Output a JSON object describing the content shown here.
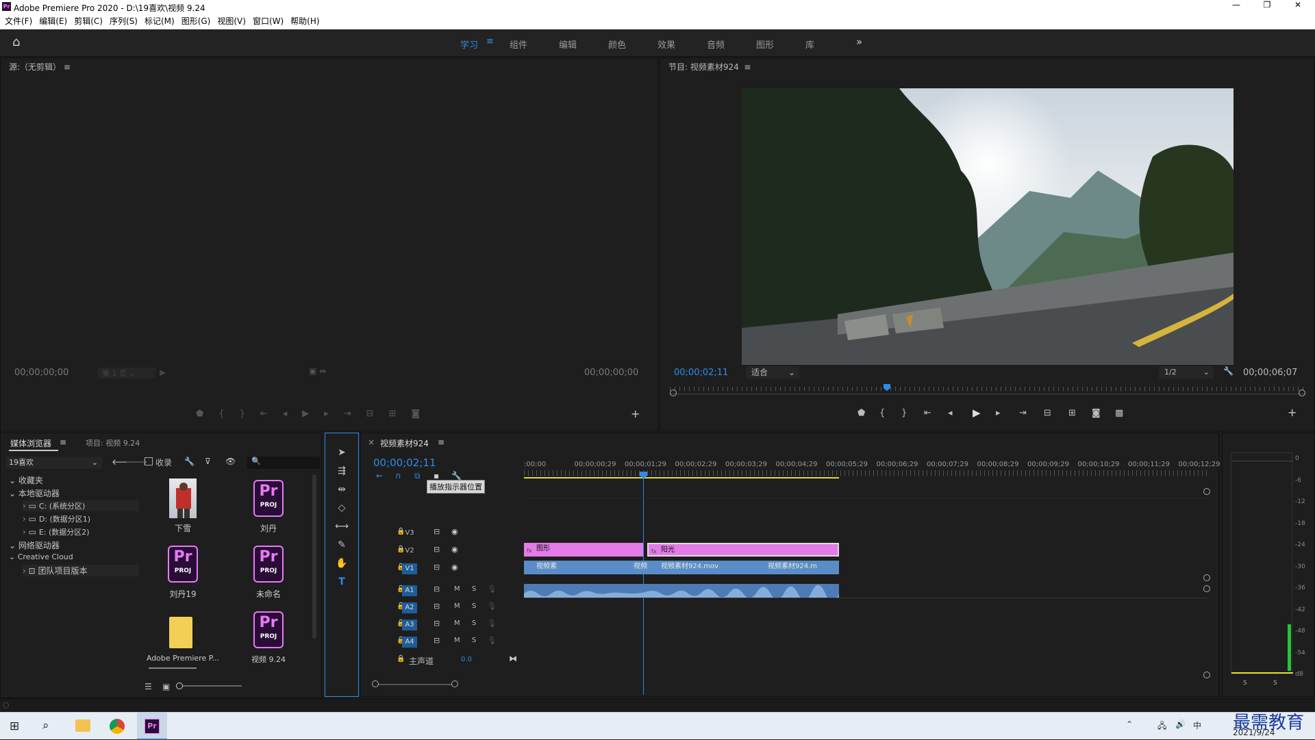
{
  "window": {
    "title": "Adobe Premiere Pro 2020 - D:\\19喜欢\\视频 9.24"
  },
  "menu": [
    "文件(F)",
    "编辑(E)",
    "剪辑(C)",
    "序列(S)",
    "标记(M)",
    "图形(G)",
    "视图(V)",
    "窗口(W)",
    "帮助(H)"
  ],
  "workspaces": {
    "tabs": [
      "学习",
      "组件",
      "编辑",
      "颜色",
      "效果",
      "音频",
      "图形",
      "库"
    ],
    "active": "学习",
    "more": "»"
  },
  "source": {
    "title": "源:（无剪辑）",
    "tc_left": "00;00;00;00",
    "page": "第 1 页",
    "tc_right": "00;00;00;00"
  },
  "program": {
    "title": "节目: 视频素材924",
    "tc_current": "00;00;02;11",
    "fit": "适合",
    "resolution": "1/2",
    "tc_duration": "00;00;06;07"
  },
  "browser": {
    "tab_media": "媒体浏览器",
    "tab_project": "项目: 视频 9.24",
    "folder": "19喜欢",
    "favorites_label": "收录",
    "tree": [
      "收藏夹",
      "本地驱动器",
      "C: (系统分区)",
      "D: (数据分区1)",
      "E: (数据分区2)",
      "网络驱动器",
      "Creative Cloud",
      "团队项目版本"
    ],
    "items": [
      "下雪",
      "刘丹",
      "刘丹19",
      "未命名",
      "Adobe Premiere P...",
      "视频 9.24"
    ],
    "proj_pr": "Pr",
    "proj_label": "PROJ"
  },
  "timeline": {
    "tab": "视频素材924",
    "tc": "00;00;02;11",
    "tooltip": "播放指示器位置",
    "ruler": [
      ":00;00",
      "00;00;00;29",
      "00;00;01;29",
      "00;00;02;29",
      "00;00;03;29",
      "00;00;04;29",
      "00;00;05;29",
      "00;00;06;29",
      "00;00;07;29",
      "00;00;08;29",
      "00;00;09;29",
      "00;00;10;29",
      "00;00;11;29",
      "00;00;12;29"
    ],
    "video_tracks": [
      "V3",
      "V2",
      "V1"
    ],
    "audio_tracks": [
      "A1",
      "A2",
      "A3",
      "A4"
    ],
    "mute": "M",
    "solo": "S",
    "master_label": "主声道",
    "master_value": "0.0",
    "clips_v2": [
      "图形",
      "阳光"
    ],
    "clips_v1": [
      "视频素",
      "视频",
      "视频素材924.mov",
      "视频素材924.m"
    ]
  },
  "meter": {
    "labels": [
      "0",
      "-6",
      "-12",
      "-18",
      "-24",
      "-30",
      "-36",
      "-42",
      "-48",
      "-54",
      "dB"
    ],
    "solo": [
      "S",
      "S"
    ]
  },
  "taskbar": {
    "date": "2021/9/24",
    "ime": "中",
    "watermark": "最需教育"
  },
  "colors": {
    "accent": "#2d8ceb",
    "graphic_clip": "#e37be8",
    "video_clip": "#5a8dc8",
    "audio_clip": "#4d7bb6"
  }
}
